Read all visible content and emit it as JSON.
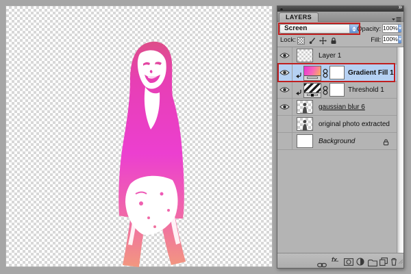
{
  "panel": {
    "tab_label": "LAYERS",
    "collapse_glyph": "»",
    "blend_mode": {
      "value": "Screen"
    },
    "opacity": {
      "label": "Opacity:",
      "value": "100%"
    },
    "lock": {
      "label": "Lock:",
      "icons": [
        "lock-transparency",
        "lock-image",
        "lock-position",
        "lock-all"
      ]
    },
    "fill": {
      "label": "Fill:",
      "value": "100%"
    },
    "layers": [
      {
        "name": "Layer 1",
        "visible": true,
        "thumb": "transparent-checker",
        "selected": false
      },
      {
        "name": "Gradient Fill 1",
        "visible": true,
        "clipped": true,
        "thumb": "gradient-fill",
        "mask": true,
        "selected": true,
        "annotated": true
      },
      {
        "name": "Threshold 1",
        "visible": true,
        "clipped": true,
        "thumb": "threshold-adjustment",
        "mask": true,
        "selected": false
      },
      {
        "name": "gaussian blur 6",
        "visible": true,
        "thumb": "photo",
        "underlined": true,
        "selected": false
      },
      {
        "name": "original photo extracted",
        "visible": false,
        "thumb": "photo",
        "selected": false
      },
      {
        "name": "Background",
        "visible": false,
        "thumb": "white",
        "italic": true,
        "locked": true,
        "selected": false
      }
    ],
    "footer": {
      "fx_label": "fx.",
      "icons": [
        "link-layers",
        "layer-style",
        "add-layer-mask",
        "new-adjustment-layer",
        "new-group",
        "new-layer",
        "delete-layer"
      ]
    }
  },
  "annotations": {
    "color": "#c01e1e",
    "targets": [
      "blend-mode-dropdown",
      "gradient-fill-layer-row"
    ]
  },
  "colors": {
    "selected_row": "#b5d0f2",
    "panel_background": "#b6b6b6",
    "figure_gradient_top": "#dd4f86",
    "figure_gradient_mid": "#ec3fd0",
    "figure_gradient_bottom": "#f2997e"
  }
}
